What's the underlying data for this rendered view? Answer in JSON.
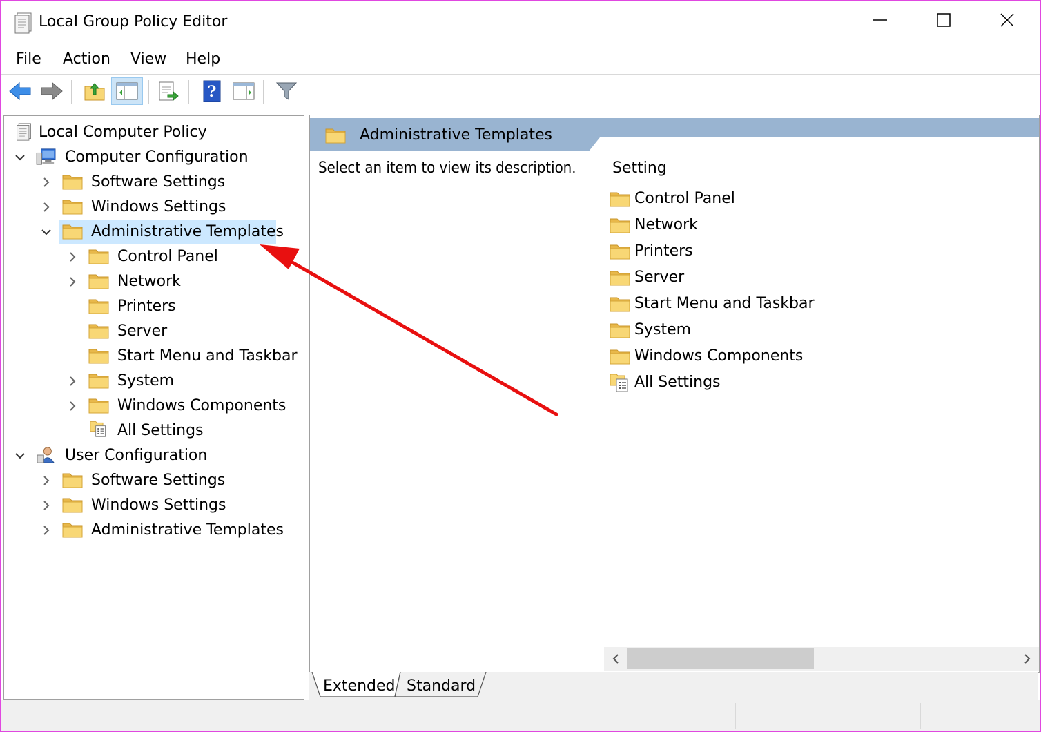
{
  "window": {
    "title": "Local Group Policy Editor"
  },
  "menu": {
    "items": [
      "File",
      "Action",
      "View",
      "Help"
    ]
  },
  "toolbar": {
    "icons": [
      "back-arrow-icon",
      "forward-arrow-icon",
      "up-folder-icon",
      "show-hide-console-tree-icon",
      "export-list-icon",
      "help-icon",
      "show-action-pane-icon",
      "filter-icon"
    ]
  },
  "tree": {
    "root": "Local Computer Policy",
    "computer_configuration": "Computer Configuration",
    "cc_software_settings": "Software Settings",
    "cc_windows_settings": "Windows Settings",
    "cc_admin_templates": "Administrative Templates",
    "at_children": [
      "Control Panel",
      "Network",
      "Printers",
      "Server",
      "Start Menu and Taskbar",
      "System",
      "Windows Components",
      "All Settings"
    ],
    "user_configuration": "User Configuration",
    "uc_software_settings": "Software Settings",
    "uc_windows_settings": "Windows Settings",
    "uc_admin_templates": "Administrative Templates"
  },
  "details": {
    "header_title": "Administrative Templates",
    "description": "Select an item to view its description.",
    "column_header": "Setting",
    "items": [
      "Control Panel",
      "Network",
      "Printers",
      "Server",
      "Start Menu and Taskbar",
      "System",
      "Windows Components",
      "All Settings"
    ]
  },
  "tabs": {
    "extended": "Extended",
    "standard": "Standard"
  },
  "colors": {
    "selection": "#cce8ff",
    "header_band": "#99b4d1",
    "annotation_arrow": "#e81010",
    "folder": "#f5d36b"
  }
}
